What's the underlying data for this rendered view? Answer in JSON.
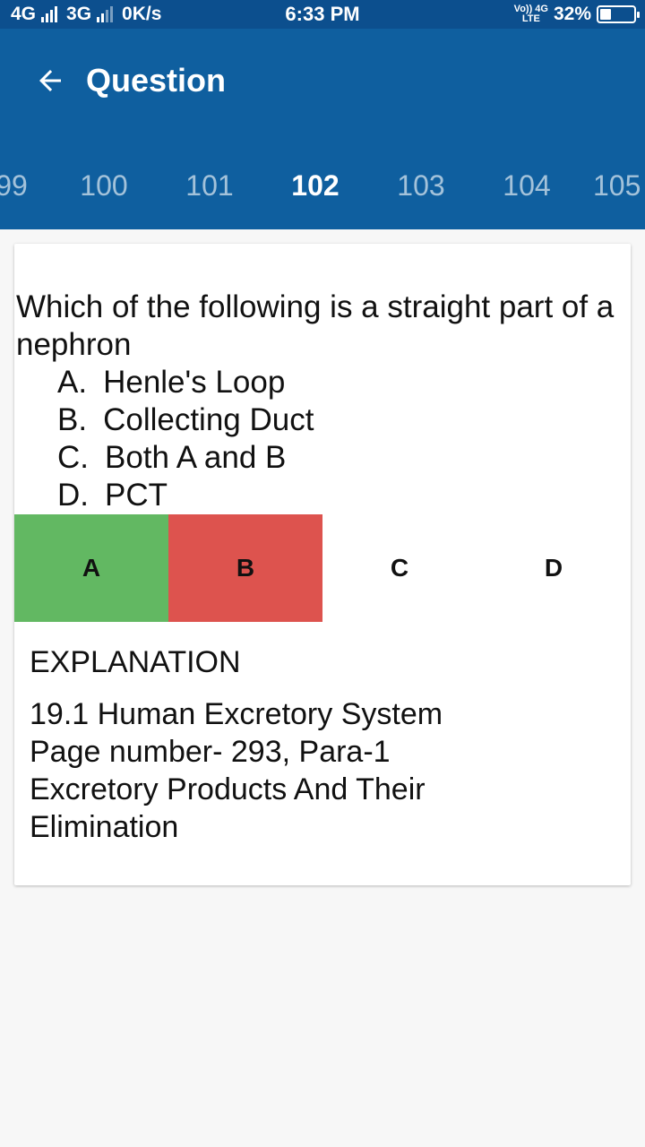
{
  "status_bar": {
    "network_1": "4G",
    "network_2": "3G",
    "speed": "0K/s",
    "time": "6:33 PM",
    "volte_top": "Vo)) 4G",
    "volte_bottom": "LTE",
    "battery": "32%",
    "battery_level": 0.32
  },
  "app_bar": {
    "title": "Question",
    "back_icon": "arrow-left-icon",
    "background_color": "#0f5f9f"
  },
  "tabs": [
    {
      "label": "99",
      "active": false
    },
    {
      "label": "100",
      "active": false
    },
    {
      "label": "101",
      "active": false
    },
    {
      "label": "102",
      "active": true
    },
    {
      "label": "103",
      "active": false
    },
    {
      "label": "104",
      "active": false
    },
    {
      "label": "105",
      "active": false
    }
  ],
  "question": {
    "text": "Which of the following is a straight part of a nephron",
    "options": [
      {
        "letter": "A.",
        "text": "Henle's Loop"
      },
      {
        "letter": "B.",
        "text": "Collecting Duct"
      },
      {
        "letter": "C.",
        "text": "Both A and B"
      },
      {
        "letter": "D.",
        "text": "PCT"
      }
    ]
  },
  "answer_buttons": [
    {
      "label": "A",
      "state": "correct",
      "color": "#62b862"
    },
    {
      "label": "B",
      "state": "wrong",
      "color": "#dd534e"
    },
    {
      "label": "C",
      "state": "none"
    },
    {
      "label": "D",
      "state": "none"
    }
  ],
  "explanation": {
    "title": "EXPLANATION",
    "lines": [
      "19.1 Human Excretory System",
      "Page number- 293, Para-1",
      "Excretory Products And Their",
      "Elimination"
    ]
  }
}
